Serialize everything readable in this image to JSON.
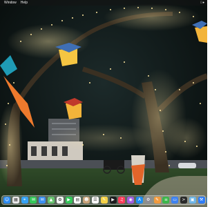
{
  "menubar": {
    "items": [
      "Window",
      "Help"
    ],
    "right_text": "●"
  },
  "dock": {
    "apps": [
      {
        "name": "finder-icon",
        "color": "#2d8cf0",
        "glyph": "☺"
      },
      {
        "name": "launchpad-icon",
        "color": "#e8e8e8",
        "glyph": "▦"
      },
      {
        "name": "safari-icon",
        "color": "#36a2f5",
        "glyph": "⌖"
      },
      {
        "name": "messages-icon",
        "color": "#35c759",
        "glyph": "✉"
      },
      {
        "name": "mail-icon",
        "color": "#3b8ff0",
        "glyph": "✉"
      },
      {
        "name": "maps-icon",
        "color": "#67c26e",
        "glyph": "▲"
      },
      {
        "name": "photos-icon",
        "color": "#f4f4f4",
        "glyph": "✿"
      },
      {
        "name": "facetime-icon",
        "color": "#34c759",
        "glyph": "▶"
      },
      {
        "name": "calendar-icon",
        "color": "#ffffff",
        "glyph": "▤"
      },
      {
        "name": "contacts-icon",
        "color": "#c8a37a",
        "glyph": "☻"
      },
      {
        "name": "reminders-icon",
        "color": "#f7f7f7",
        "glyph": "☰"
      },
      {
        "name": "notes-icon",
        "color": "#f5d247",
        "glyph": "✎"
      },
      {
        "name": "tv-icon",
        "color": "#1c1c1e",
        "glyph": "▶"
      },
      {
        "name": "music-icon",
        "color": "#fb3c5a",
        "glyph": "♫"
      },
      {
        "name": "podcasts-icon",
        "color": "#a05cdf",
        "glyph": "◉"
      },
      {
        "name": "appstore-icon",
        "color": "#1e8ef0",
        "glyph": "A"
      },
      {
        "name": "system-settings-icon",
        "color": "#8e8e93",
        "glyph": "⚙"
      },
      {
        "name": "pages-icon",
        "color": "#f19a3e",
        "glyph": "✎"
      },
      {
        "name": "numbers-icon",
        "color": "#3cb64b",
        "glyph": "≡"
      },
      {
        "name": "keynote-icon",
        "color": "#3e82f0",
        "glyph": "▭"
      },
      {
        "name": "terminal-icon",
        "color": "#2a2a2a",
        "glyph": ">"
      },
      {
        "name": "preview-icon",
        "color": "#6fb6e8",
        "glyph": "▣"
      },
      {
        "name": "xcode-icon",
        "color": "#2f7cf6",
        "glyph": "⚒"
      },
      {
        "name": "appstore-blue-icon",
        "color": "#2b8df2",
        "glyph": "A"
      }
    ],
    "trailing": [
      {
        "name": "downloads-folder-icon",
        "color": "#4aa5e8",
        "glyph": "⇩"
      },
      {
        "name": "trash-icon",
        "color": "#d7dbe0",
        "glyph": "♲"
      }
    ]
  }
}
